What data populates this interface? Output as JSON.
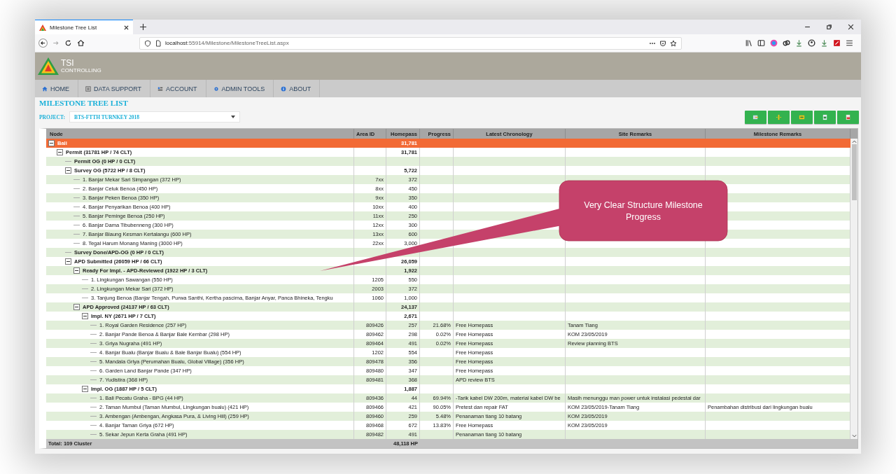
{
  "browser": {
    "tab_title": "Milestone Tree List",
    "url_host": "localhost",
    "url_path": ":55914/Milestone/MilestoneTreeList.aspx"
  },
  "header": {
    "logo_title": "TSI",
    "logo_subtitle": "CONTROLLING"
  },
  "nav": [
    {
      "label": "HOME"
    },
    {
      "label": "DATA SUPPORT"
    },
    {
      "label": "ACCOUNT"
    },
    {
      "label": "ADMIN TOOLS"
    },
    {
      "label": "ABOUT"
    }
  ],
  "page_title": "MILESTONE TREE LIST",
  "project": {
    "label": "PROJECT:",
    "value": "BTS-FTTH TURNKEY 2018"
  },
  "columns": [
    "Node",
    "Area ID",
    "Homepass",
    "Progress",
    "Latest Chronology",
    "Site Remarks",
    "Milestone Remarks"
  ],
  "tree": [
    {
      "node": "Bali",
      "kind": "group",
      "homepass": "31,781",
      "expanded": true,
      "children": [
        {
          "node": "Permit (31781 HP / 74 CLT)",
          "kind": "group",
          "homepass": "31,781",
          "expanded": true,
          "children": [
            {
              "node": "Permit OG (0 HP / 0 CLT)",
              "kind": "group"
            },
            {
              "node": "Survey OG (5722 HP / 8 CLT)",
              "kind": "group",
              "homepass": "5,722",
              "expanded": true,
              "children": [
                {
                  "node": "1. Banjar Mekar Sari Simpangan (372 HP)",
                  "kind": "item",
                  "area_id": "7xx",
                  "homepass": "372"
                },
                {
                  "node": "2. Banjar Celuk Benoa (450 HP)",
                  "kind": "item",
                  "area_id": "8xx",
                  "homepass": "450"
                },
                {
                  "node": "3. Banjar Peken Benoa (350 HP)",
                  "kind": "item",
                  "area_id": "9xx",
                  "homepass": "350"
                },
                {
                  "node": "4. Banjar Penyarikan Benoa (400 HP)",
                  "kind": "item",
                  "area_id": "10xx",
                  "homepass": "400"
                },
                {
                  "node": "5. Banjar Peminge Benoa (250 HP)",
                  "kind": "item",
                  "area_id": "11xx",
                  "homepass": "250"
                },
                {
                  "node": "6. Banjar Dama Tibubenneng (300 HP)",
                  "kind": "item",
                  "area_id": "12xx",
                  "homepass": "300"
                },
                {
                  "node": "7. Banjar Blaung Kesman Kertalangu (600 HP)",
                  "kind": "item",
                  "area_id": "13xx",
                  "homepass": "600"
                },
                {
                  "node": "8. Tegal Harum Monang Maning (3000 HP)",
                  "kind": "item",
                  "area_id": "22xx",
                  "homepass": "3,000"
                }
              ]
            },
            {
              "node": "Survey Done/APD-OG (0 HP / 0 CLT)",
              "kind": "group"
            },
            {
              "node": "APD Submitted (26059 HP / 66 CLT)",
              "kind": "group",
              "homepass": "26,059",
              "expanded": true,
              "children": [
                {
                  "node": "Ready For Impl. - APD-Reviewed (1922 HP / 3 CLT)",
                  "kind": "group",
                  "homepass": "1,922",
                  "expanded": true,
                  "children": [
                    {
                      "node": "1. Lingkungan Sawangan (550 HP)",
                      "kind": "item",
                      "area_id": "1205",
                      "homepass": "550"
                    },
                    {
                      "node": "2. Lingkungan Mekar Sari (372 HP)",
                      "kind": "item",
                      "area_id": "2003",
                      "homepass": "372"
                    },
                    {
                      "node": "3. Tanjung Benoa (Banjar Tengah, Purwa Santhi, Kertha pascima, Banjar Anyar, Panca Bhineka, Tengku",
                      "kind": "item",
                      "area_id": "1060",
                      "homepass": "1,000"
                    }
                  ]
                },
                {
                  "node": "APD Approved (24137 HP / 63 CLT)",
                  "kind": "group",
                  "homepass": "24,137",
                  "expanded": true,
                  "children": [
                    {
                      "node": "Impl. NY (2671 HP / 7 CLT)",
                      "kind": "group",
                      "homepass": "2,671",
                      "expanded": true,
                      "children": [
                        {
                          "node": "1. Royal Garden Residence (257 HP)",
                          "kind": "item",
                          "area_id": "809426",
                          "homepass": "257",
                          "progress": "21.68%",
                          "chronology": "Free Homepass",
                          "site_remarks": "Tanam Tiang"
                        },
                        {
                          "node": "2. Banjar Pande Benoa & Banjar Bale Kembar (298 HP)",
                          "kind": "item",
                          "area_id": "809462",
                          "homepass": "298",
                          "progress": "0.02%",
                          "chronology": "Free Homepass",
                          "site_remarks": "KOM 23/05/2019"
                        },
                        {
                          "node": "3. Griya Nugraha (491 HP)",
                          "kind": "item",
                          "area_id": "809464",
                          "homepass": "491",
                          "progress": "0.02%",
                          "chronology": "Free Homepass",
                          "site_remarks": "Review planning BTS"
                        },
                        {
                          "node": "4. Banjar Bualu (Banjar Bualu & Bale Banjar Bualu) (554 HP)",
                          "kind": "item",
                          "area_id": "1202",
                          "homepass": "554",
                          "chronology": "Free Homepass"
                        },
                        {
                          "node": "5. Mandala Griya (Perumahan Bualu, Global Village) (356 HP)",
                          "kind": "item",
                          "area_id": "809478",
                          "homepass": "356",
                          "chronology": "Free Homepass"
                        },
                        {
                          "node": "6. Garden Land Banjar Pande (347 HP)",
                          "kind": "item",
                          "area_id": "809480",
                          "homepass": "347",
                          "chronology": "Free Homepass"
                        },
                        {
                          "node": "7. Yudistira (368 HP)",
                          "kind": "item",
                          "area_id": "809481",
                          "homepass": "368",
                          "chronology": "APD review BTS"
                        }
                      ]
                    },
                    {
                      "node": "Impl. OG (1887 HP / 5 CLT)",
                      "kind": "group",
                      "homepass": "1,887",
                      "expanded": true,
                      "children": [
                        {
                          "node": "1. Bali Pecatu Graha - BPG (44 HP)",
                          "kind": "item",
                          "area_id": "809436",
                          "homepass": "44",
                          "progress": "69.94%",
                          "chronology": "-Tarik kabel DW 200m, material kabel DW be",
                          "site_remarks": "Masih menunggu man power untuk instalasi pedestal dar"
                        },
                        {
                          "node": "2. Taman Mumbul (Taman Mumbul, Lingkungan bualu) (421 HP)",
                          "kind": "item",
                          "area_id": "809466",
                          "homepass": "421",
                          "progress": "90.05%",
                          "chronology": "Pretest dan repair FAT",
                          "site_remarks": "KOM 23/05/2019-Tanam Tiang",
                          "milestone_remarks": "Penambahan distribusi dari lingkungan bualu"
                        },
                        {
                          "node": "3. Ambengan (Ambengan, Angkasa Pura, & Living Hill) (259 HP)",
                          "kind": "item",
                          "area_id": "809460",
                          "homepass": "259",
                          "progress": "5.48%",
                          "chronology": "Penanaman tiang 10 batang",
                          "site_remarks": "KOM 23/05/2019"
                        },
                        {
                          "node": "4. Banjar Taman Griya (672 HP)",
                          "kind": "item",
                          "area_id": "809468",
                          "homepass": "672",
                          "progress": "13.83%",
                          "chronology": "Free Homepass",
                          "site_remarks": "KOM 23/05/2019"
                        },
                        {
                          "node": "5. Sekar Jepun Kerta Graha (491 HP)",
                          "kind": "item",
                          "area_id": "809482",
                          "homepass": "491",
                          "chronology": "Penanaman tiang 10 batang"
                        }
                      ]
                    }
                  ]
                }
              ]
            }
          ]
        }
      ]
    }
  ],
  "footer": {
    "node": "Total: 109 Cluster",
    "homepass": "48,118 HP"
  },
  "callout": "Very Clear Structure Milestone Progress"
}
